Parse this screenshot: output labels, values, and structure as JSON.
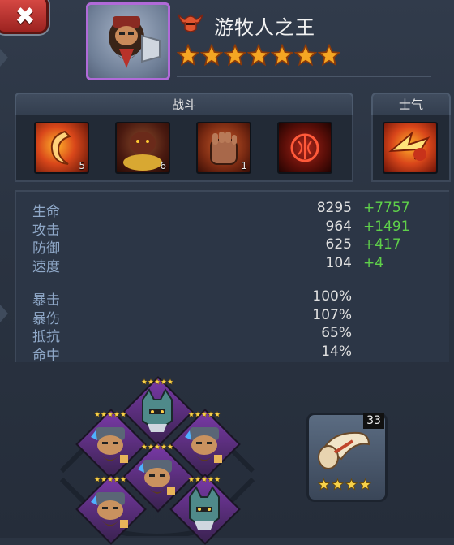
{
  "hero": {
    "name": "游牧人之王",
    "stars": 7,
    "star_color": "#f5a623",
    "frame_color": "#b06ad8",
    "faction_icon": "horned-helmet-icon"
  },
  "close_icon": "close-icon",
  "tabs": {
    "battle": "战斗",
    "morale": "士气"
  },
  "skills": [
    {
      "icon": "fire-claw-icon",
      "level": "5"
    },
    {
      "icon": "gold-beast-icon",
      "level": "6"
    },
    {
      "icon": "stone-fist-icon",
      "level": "1"
    },
    {
      "icon": "rune-circle-icon",
      "level": ""
    }
  ],
  "morale_skill": {
    "icon": "fire-dash-icon"
  },
  "stats": [
    {
      "label": "生命",
      "value": "8295",
      "bonus": "+7757"
    },
    {
      "label": "攻击",
      "value": "964",
      "bonus": "+1491"
    },
    {
      "label": "防御",
      "value": "625",
      "bonus": "+417"
    },
    {
      "label": "速度",
      "value": "104",
      "bonus": "+4"
    }
  ],
  "sec_stats": [
    {
      "label": "暴击",
      "value": "100%"
    },
    {
      "label": "暴伤",
      "value": "107%"
    },
    {
      "label": "抵抗",
      "value": "65%"
    },
    {
      "label": "命中",
      "value": "14%"
    }
  ],
  "formation": [
    {
      "unit": "wolf-helmet-icon",
      "stars": 5
    },
    {
      "unit": "dwarf-warrior-icon",
      "stars": 5
    },
    {
      "unit": "dwarf-warrior-icon",
      "stars": 5
    },
    {
      "unit": "dwarf-warrior-icon",
      "stars": 5
    },
    {
      "unit": "dwarf-warrior-icon",
      "stars": 5
    },
    {
      "unit": "wolf-helmet-icon",
      "stars": 5
    }
  ],
  "artifact": {
    "icon": "war-horn-icon",
    "count": "33",
    "stars": 4
  },
  "colors": {
    "bonus_green": "#5fd14a",
    "stat_label": "#8fa8c8",
    "slot_purple": "#7a3aa8"
  }
}
